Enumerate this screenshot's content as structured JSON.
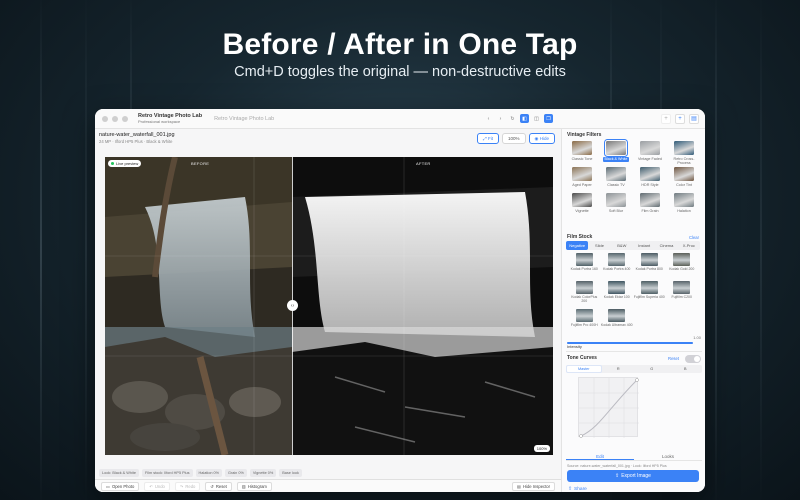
{
  "headline": "Before / After in One Tap",
  "subheadline": "Cmd+D toggles the original — non-destructive edits",
  "window": {
    "app_name": "Retro Vintage Photo Lab",
    "app_subtitle": "Professional workspace",
    "title": "Retro Vintage Photo Lab",
    "file_name": "nature-water_waterfall_001.jpg",
    "file_meta": "24 MP · Ilford HP5 Plus · Black & White",
    "fit_label": "Fit",
    "zoom_label": "100%",
    "hide_label": "Hide",
    "live_preview": "Live preview",
    "before_label": "BEFORE",
    "after_label": "AFTER",
    "zoom_badge": "100%"
  },
  "chips": [
    "Look: Black & White",
    "Film stock: Ilford HP5 Plus",
    "Halation 0%",
    "Grain 0%",
    "Vignette 0%",
    "Base look"
  ],
  "bottom_bar": {
    "open": "Open Photo",
    "undo": "Undo",
    "redo": "Redo",
    "reset": "Reset",
    "histogram": "Histogram",
    "hide_inspector": "Hide Inspector"
  },
  "sidebar": {
    "vintage_title": "Vintage Filters",
    "filters": [
      {
        "label": "Classic Tone",
        "color": "#8a6a45"
      },
      {
        "label": "Black & White",
        "color": "#7a7a7a"
      },
      {
        "label": "Vintage Faded",
        "color": "#9a9ea2"
      },
      {
        "label": "Retro Cross-Process",
        "color": "#2f5a78"
      },
      {
        "label": "Aged Paper",
        "color": "#8b7355"
      },
      {
        "label": "Classic TV",
        "color": "#5a6b74"
      },
      {
        "label": "HDR Style",
        "color": "#3f5d6e"
      },
      {
        "label": "Color Tint",
        "color": "#6e5540"
      },
      {
        "label": "Vignette",
        "color": "#4a4a4a"
      },
      {
        "label": "Soft Blur",
        "color": "#8c9296"
      },
      {
        "label": "Film Grain",
        "color": "#5f6a70"
      },
      {
        "label": "Halation",
        "color": "#6f7a80"
      }
    ],
    "selected_filter": 1,
    "film_title": "Film Stock",
    "film_clear": "Clear",
    "film_tabs": [
      "Negative",
      "Slide",
      "B&W",
      "Instant",
      "Cinema",
      "X-Proc"
    ],
    "film_tab_selected": 0,
    "stocks": [
      {
        "label": "Kodak Portra 160",
        "color": "#4f5f66"
      },
      {
        "label": "Kodak Portra 400",
        "color": "#56666d"
      },
      {
        "label": "Kodak Portra 800",
        "color": "#4a5a62"
      },
      {
        "label": "Kodak Gold 200",
        "color": "#5b5f58"
      },
      {
        "label": "Kodak ColorPlus 200",
        "color": "#546168"
      },
      {
        "label": "Kodak Ektar 100",
        "color": "#3f5561"
      },
      {
        "label": "Fujifilm Superia 400",
        "color": "#4d5e64"
      },
      {
        "label": "Fujifilm C200",
        "color": "#57636a"
      },
      {
        "label": "Fujifilm Pro 400H",
        "color": "#5a6b72"
      },
      {
        "label": "Kodak Ultramax 400",
        "color": "#4b5b62"
      }
    ],
    "intensity_label": "Intensity",
    "intensity_value": "1.00",
    "intensity_fraction": 1.0,
    "tone_title": "Tone Curves",
    "tone_reset": "Reset",
    "curve_tabs": [
      "Master",
      "R",
      "G",
      "B"
    ],
    "curve_tab_selected": 0,
    "editor_tabs": [
      "Edit",
      "Looks"
    ],
    "editor_tab_selected": 0,
    "source": "Source: nature-water_waterfall_001.jpg · Look: Ilford HP5 Plus",
    "export_label": "Export Image",
    "share_label": "Share"
  }
}
